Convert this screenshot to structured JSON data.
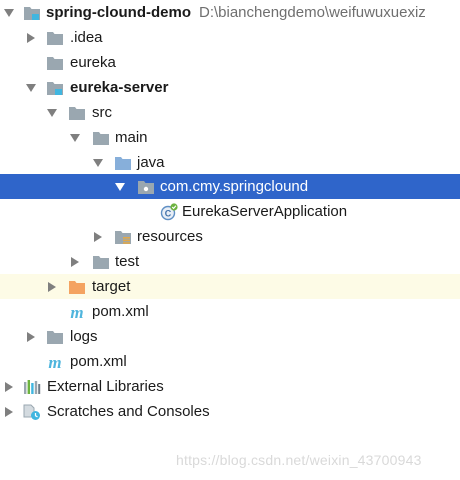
{
  "tree": {
    "root": {
      "name": "spring-clound-demo",
      "path": "D:\\bianchengdemo\\weifuwuxuexiz",
      "expanded": true,
      "icon": "module-folder-icon"
    },
    "idea": {
      "name": ".idea",
      "expanded": false,
      "icon": "folder-icon"
    },
    "eureka": {
      "name": "eureka",
      "icon": "folder-icon"
    },
    "eureka_server": {
      "name": "eureka-server",
      "expanded": true,
      "icon": "module-folder-icon"
    },
    "src": {
      "name": "src",
      "expanded": true,
      "icon": "folder-icon"
    },
    "main": {
      "name": "main",
      "expanded": true,
      "icon": "folder-icon"
    },
    "java": {
      "name": "java",
      "expanded": true,
      "icon": "source-root-folder-icon"
    },
    "package": {
      "name": "com.cmy.springclound",
      "expanded": true,
      "selected": true,
      "icon": "package-icon"
    },
    "app_class": {
      "name": "EurekaServerApplication",
      "icon": "spring-boot-class-icon"
    },
    "resources": {
      "name": "resources",
      "expanded": false,
      "icon": "resources-folder-icon"
    },
    "test": {
      "name": "test",
      "expanded": false,
      "icon": "folder-icon"
    },
    "target": {
      "name": "target",
      "expanded": false,
      "icon": "excluded-folder-icon"
    },
    "module_pom": {
      "name": "pom.xml",
      "icon": "maven-icon"
    },
    "logs": {
      "name": "logs",
      "expanded": false,
      "icon": "folder-icon"
    },
    "root_pom": {
      "name": "pom.xml",
      "icon": "maven-icon"
    },
    "external_libraries": {
      "name": "External Libraries",
      "expanded": false,
      "icon": "libraries-icon"
    },
    "scratches": {
      "name": "Scratches and Consoles",
      "expanded": false,
      "icon": "scratches-icon"
    }
  },
  "watermark": "https://blog.csdn.net/weixin_43700943",
  "colors": {
    "selection": "#2f65ca",
    "excluded_background": "#fdfbe6",
    "folder": "#9aa7b0",
    "source_root": "#87afda",
    "excluded_folder": "#f4a361",
    "module_marker": "#40b6e0",
    "maven": "#4fb5dd"
  }
}
